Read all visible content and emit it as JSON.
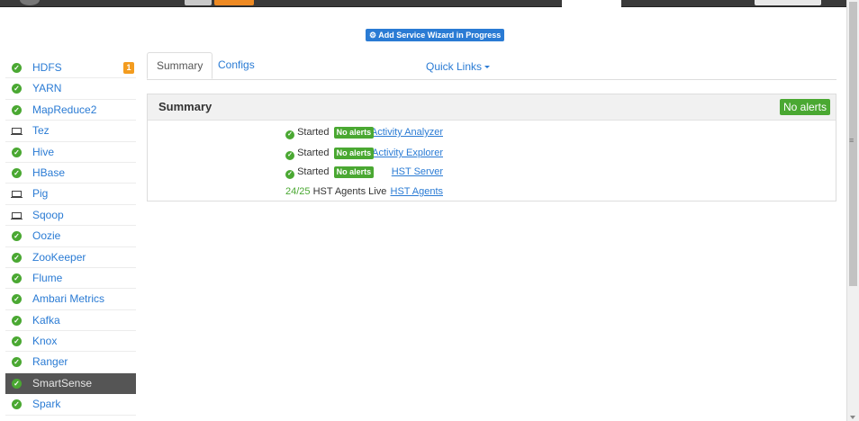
{
  "header": {
    "wizard_label": "Add Service Wizard in Progress"
  },
  "sidebar": {
    "items": [
      {
        "label": "HDFS",
        "status": "check",
        "badge": "1"
      },
      {
        "label": "YARN",
        "status": "check"
      },
      {
        "label": "MapReduce2",
        "status": "check"
      },
      {
        "label": "Tez",
        "status": "client"
      },
      {
        "label": "Hive",
        "status": "check"
      },
      {
        "label": "HBase",
        "status": "check"
      },
      {
        "label": "Pig",
        "status": "client"
      },
      {
        "label": "Sqoop",
        "status": "client"
      },
      {
        "label": "Oozie",
        "status": "check"
      },
      {
        "label": "ZooKeeper",
        "status": "check"
      },
      {
        "label": "Flume",
        "status": "check"
      },
      {
        "label": "Ambari Metrics",
        "status": "check"
      },
      {
        "label": "Kafka",
        "status": "check"
      },
      {
        "label": "Knox",
        "status": "check"
      },
      {
        "label": "Ranger",
        "status": "check"
      },
      {
        "label": "SmartSense",
        "status": "check",
        "active": true
      },
      {
        "label": "Spark",
        "status": "check"
      }
    ]
  },
  "tabs": {
    "summary": "Summary",
    "configs": "Configs",
    "quick_links": "Quick Links"
  },
  "summary": {
    "title": "Summary",
    "alert_badge": "No alerts",
    "rows": [
      {
        "label": "Activity Analyzer",
        "state": "Started",
        "alert": "No alerts"
      },
      {
        "label": "Activity Explorer",
        "state": "Started",
        "alert": "No alerts"
      },
      {
        "label": "HST Server",
        "state": "Started",
        "alert": "No alerts"
      },
      {
        "label": "HST Agents",
        "count": "24/25",
        "text": "HST Agents Live"
      }
    ]
  },
  "colors": {
    "link": "#2a7bd4",
    "success": "#4aa832",
    "warning": "#f39c1f",
    "active_bg": "#555555"
  }
}
